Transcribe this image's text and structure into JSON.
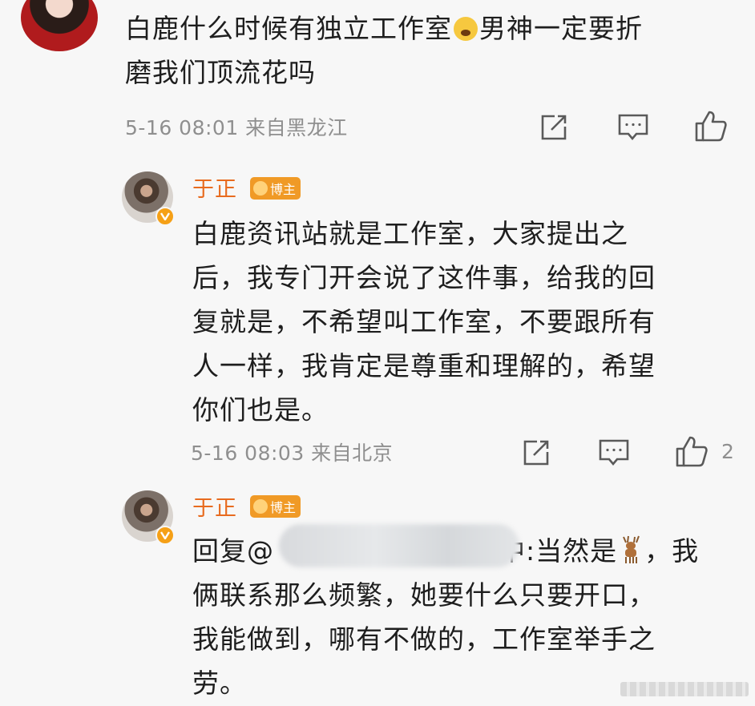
{
  "top_comment": {
    "text_line1": "白鹿什么时候有独立工作室",
    "text_line1_cont": "男神一定要折",
    "text_line2": "磨我们顶流花吗",
    "meta": "5-16 08:01 来自黑龙江"
  },
  "reply1": {
    "username": "于正",
    "badge": "博主",
    "lines": [
      "白鹿资讯站就是工作室，大家提出之",
      "后，我专门开会说了这件事，给我的回",
      "复就是，不希望叫工作室，不要跟所有",
      "人一样，我肯定是尊重和理解的，希望",
      "你们也是。"
    ],
    "meta": "5-16 08:03 来自北京",
    "likes": "2"
  },
  "reply2": {
    "username": "于正",
    "badge": "博主",
    "line1_prefix": "回复@",
    "line1_mid": "中:当然是",
    "line1_suffix": "，我",
    "lines": [
      "俩联系那么频繁，她要什么只要开口，",
      "我能做到，哪有不做的，工作室举手之",
      "劳。"
    ]
  },
  "icons": {
    "share": "share-icon",
    "comment": "comment-icon",
    "like": "thumbs-up-icon",
    "verified": "verified-v-icon",
    "emoji_scream": "scream-emoji-icon",
    "emoji_deer": "deer-emoji-icon"
  },
  "colors": {
    "username": "#e86b1f",
    "badge": "#f09a26",
    "meta": "#8f8f8f",
    "background": "#f7f7f7"
  }
}
